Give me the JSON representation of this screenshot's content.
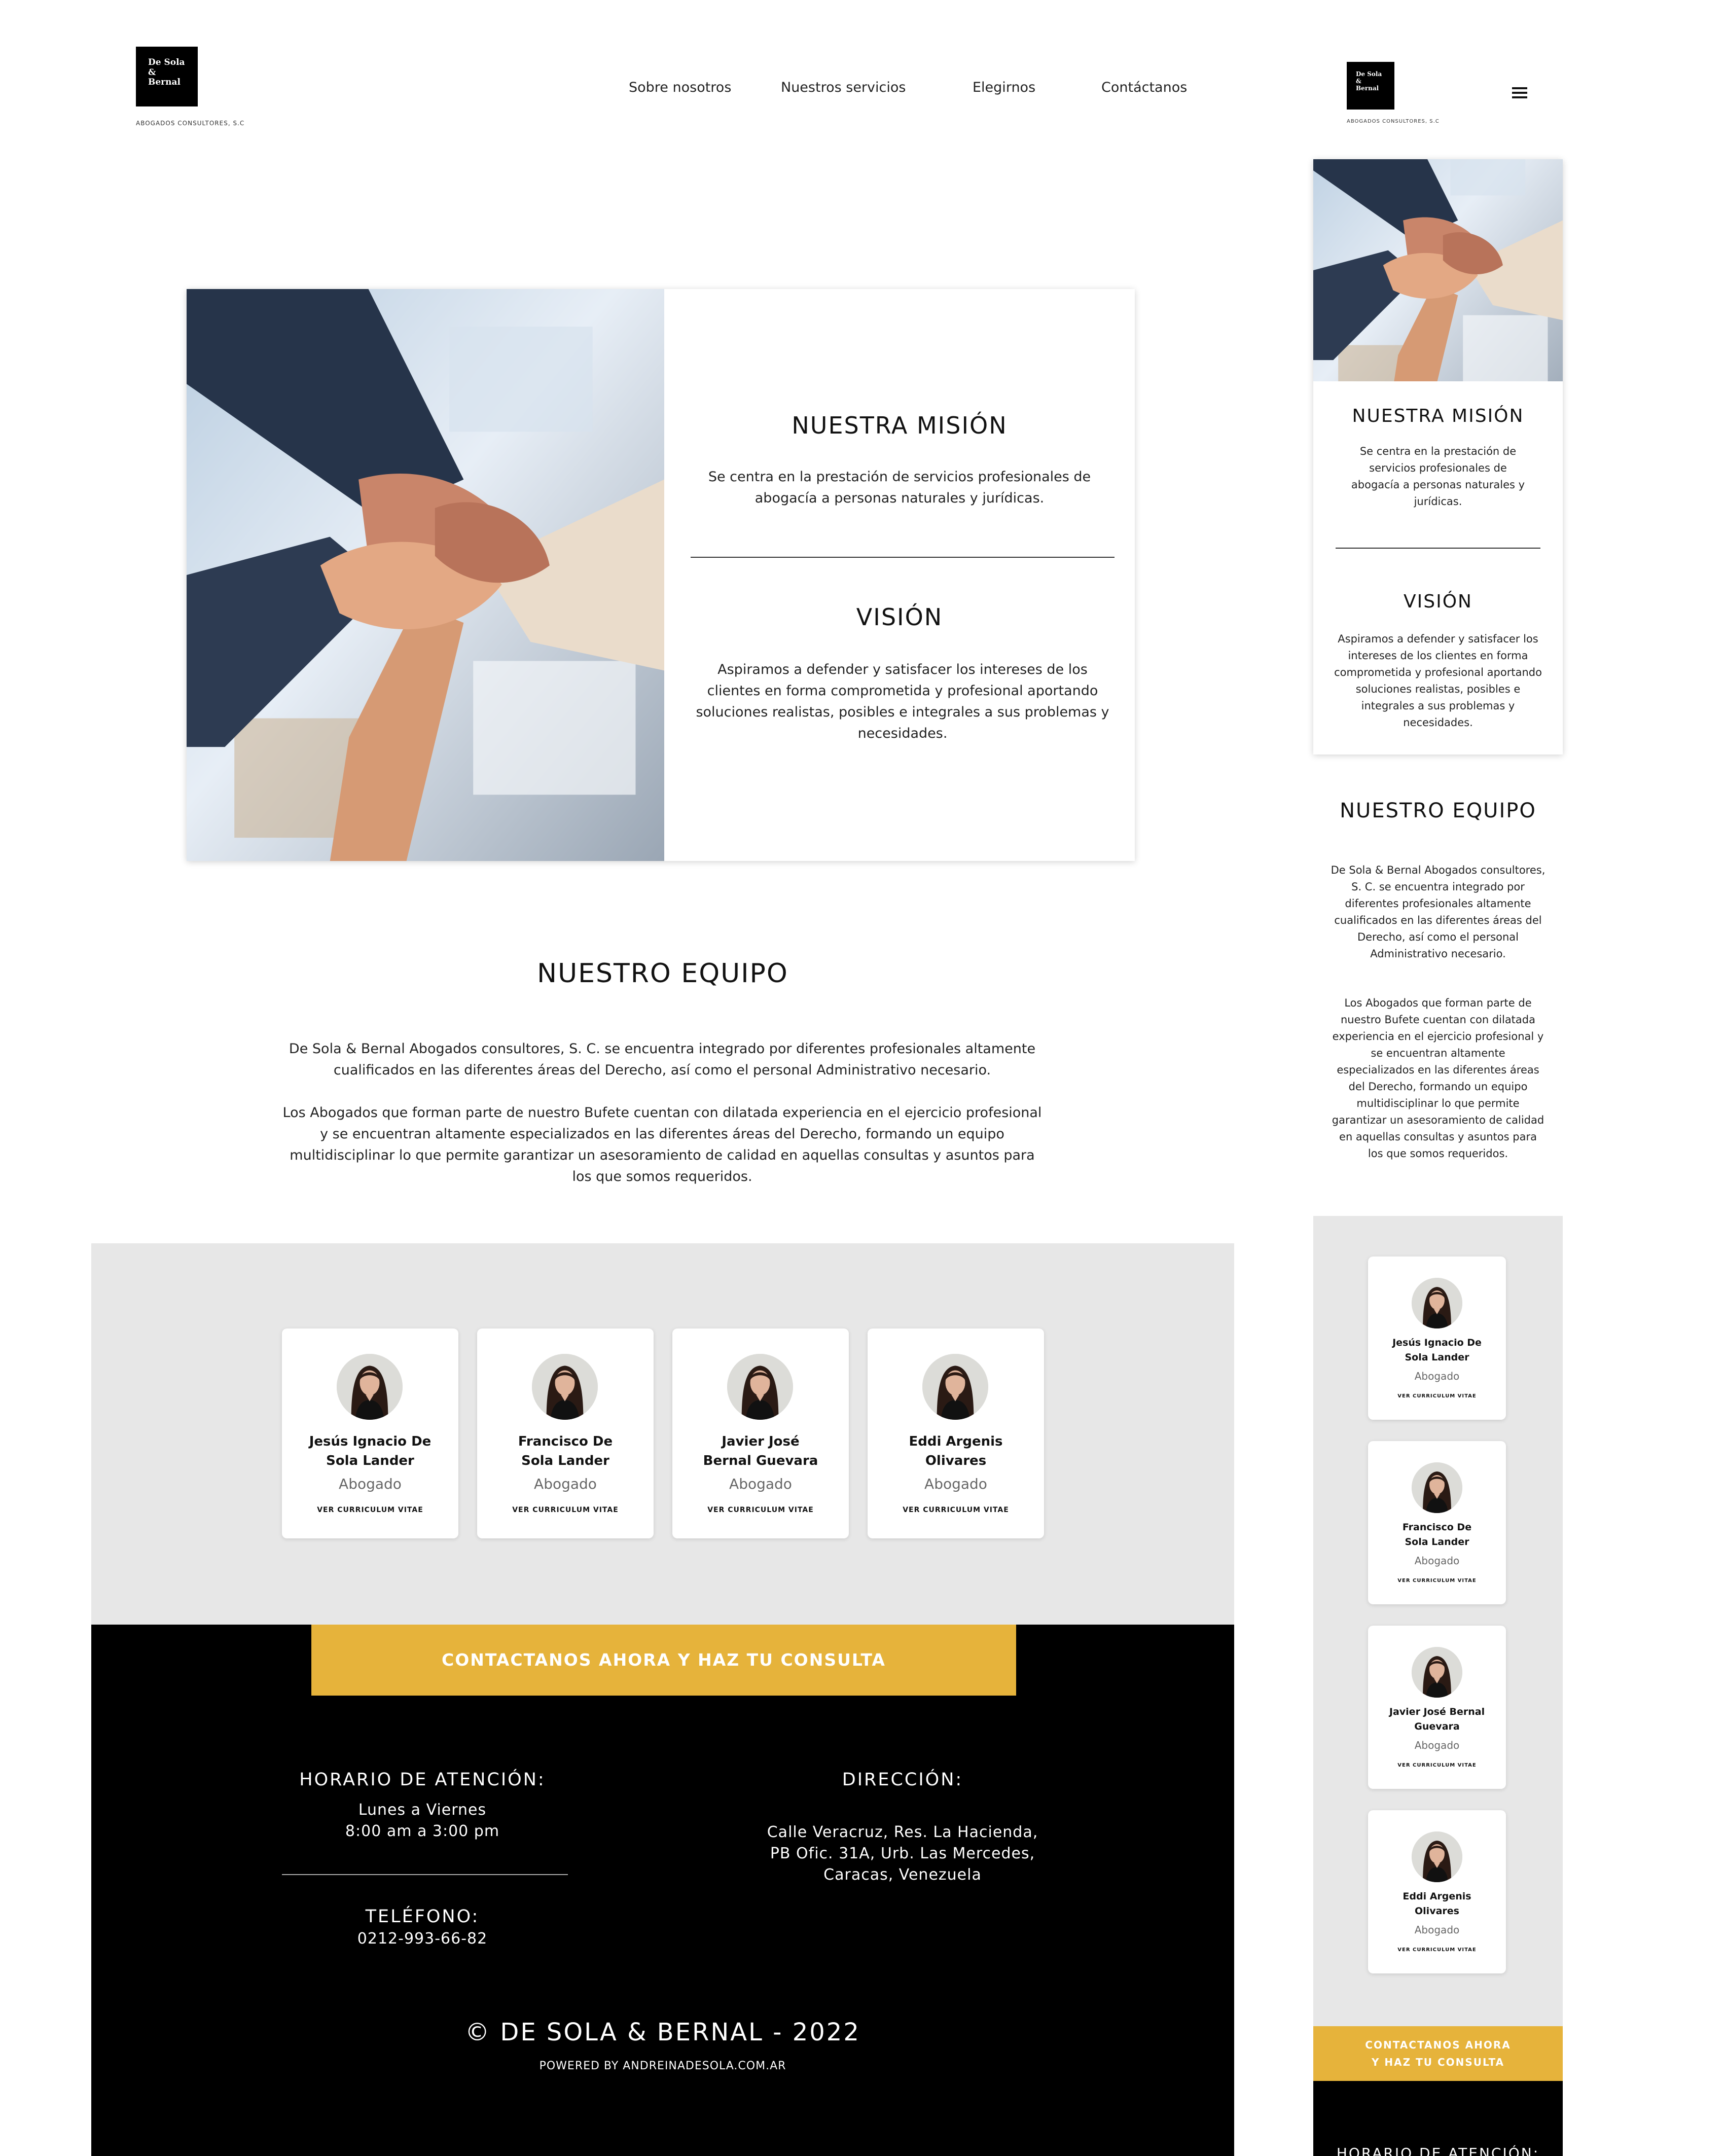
{
  "brand": {
    "logo_line1": "De Sola",
    "logo_line2": "&",
    "logo_line3": "Bernal",
    "tagline": "ABOGADOS CONSULTORES, S.C"
  },
  "nav": {
    "items": [
      {
        "label": "Sobre nosotros"
      },
      {
        "label": "Nuestros servicios"
      },
      {
        "label": "Elegirnos"
      },
      {
        "label": "Contáctanos"
      }
    ]
  },
  "mission": {
    "title": "NUESTRA MISIÓN",
    "text": "Se centra en la prestación de servicios profesionales de abogacía a personas naturales y jurídicas."
  },
  "vision": {
    "title": "VISIÓN",
    "text": "Aspiramos a defender y satisfacer los intereses de los clientes en forma comprometida y profesional aportando soluciones realistas, posibles e integrales a sus problemas y necesidades."
  },
  "team": {
    "title": "NUESTRO EQUIPO",
    "para1": "De Sola & Bernal Abogados consultores, S. C. se encuentra integrado por diferentes profesionales altamente cualificados en las diferentes áreas del Derecho, así como el personal Administrativo necesario.",
    "para2": "Los Abogados que forman parte de nuestro Bufete cuentan con dilatada experiencia en el ejercicio profesional y se encuentran altamente especializados en las diferentes áreas del Derecho, formando un equipo multidisciplinar lo que permite garantizar un asesoramiento de calidad en aquellas consultas y asuntos para los que somos requeridos.",
    "members": [
      {
        "name": "Jesús Ignacio De Sola Lander",
        "role": "Abogado",
        "cv": "VER CURRICULUM VITAE"
      },
      {
        "name": "Francisco De Sola Lander",
        "role": "Abogado",
        "cv": "VER CURRICULUM VITAE"
      },
      {
        "name": "Javier José Bernal Guevara",
        "role": "Abogado",
        "cv": "VER CURRICULUM VITAE"
      },
      {
        "name": "Eddi Argenis Olivares",
        "role": "Abogado",
        "cv": "VER CURRICULUM VITAE"
      }
    ]
  },
  "cta": {
    "desktop_label": "CONTACTANOS AHORA Y HAZ TU CONSULTA",
    "mobile_line1": "CONTACTANOS AHORA",
    "mobile_line2": "Y HAZ TU CONSULTA"
  },
  "footer": {
    "hours_title": "HORARIO DE ATENCIÓN:",
    "hours_days": "Lunes a Viernes",
    "hours_time": "8:00 am a 3:00 pm",
    "phone_title": "TELÉFONO:",
    "phone": "0212-993-66-82",
    "address_title": "DIRECCIÓN:",
    "address_line1": "Calle Veracruz, Res. La Hacienda,",
    "address_line2": "PB Ofic. 31A, Urb. Las Mercedes,",
    "address_line3": "Caracas, Venezuela",
    "copyright": "© DE SOLA & BERNAL - 2022",
    "powered": "POWERED BY ANDREINADESOLA.COM.AR"
  },
  "colors": {
    "accent_gold": "#e6b33b",
    "footer_bg": "#000000",
    "band_gray": "#e7e7e7"
  },
  "icons": {
    "menu": "hamburger-icon"
  }
}
